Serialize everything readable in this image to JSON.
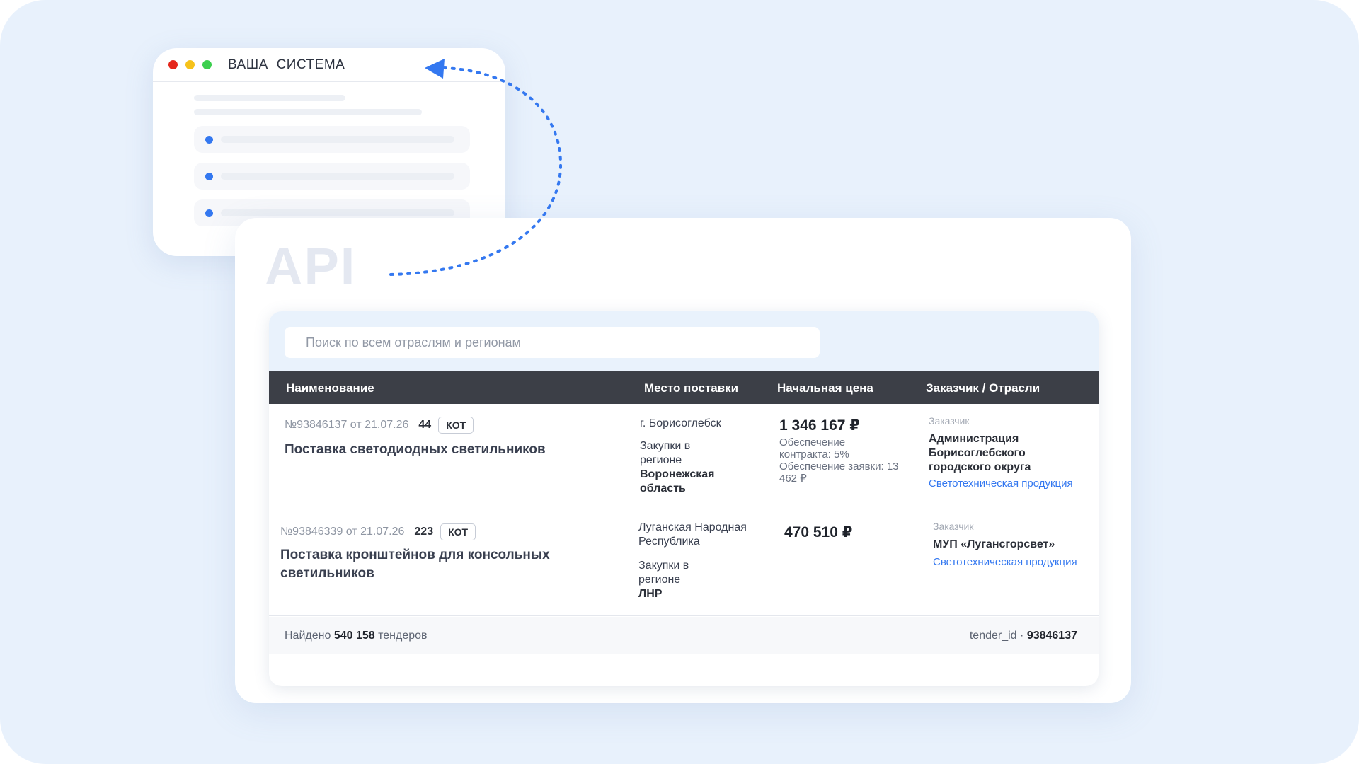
{
  "system_window": {
    "title": "ВАША СИСТЕМА",
    "dot_colors": [
      "#e5271b",
      "#f6c21a",
      "#3ccf4e"
    ]
  },
  "api_card": {
    "label": "API"
  },
  "search": {
    "placeholder": "Поиск по всем отраслям и регионам"
  },
  "table": {
    "columns": [
      "Наименование",
      "Место поставки",
      "Начальная цена",
      "Заказчик / Отрасли"
    ],
    "rows": [
      {
        "number": "№93846137 от 21.07.26",
        "law": "44",
        "badge": "КОТ",
        "name": "Поставка светодиодных светильников",
        "city": "г. Борисоглебск",
        "region_label": "Закупки в регионе",
        "region": "Воронежская область",
        "price": "1 346 167 ₽",
        "price_note": "Обеспечение контракта: 5% Обеспечение заявки: 13 462 ₽",
        "customer_label": "Заказчик",
        "customer": "Администрация Борисоглебского городского округа",
        "industry": "Светотехническая продукция"
      },
      {
        "number": "№93846339 от 21.07.26",
        "law": "223",
        "badge": "КОТ",
        "name": "Поставка кронштейнов для консольных светильников",
        "city": "Луганская Народная Республика",
        "region_label": "Закупки в регионе",
        "region": "ЛНР",
        "price": "470 510 ₽",
        "price_note": "",
        "customer_label": "Заказчик",
        "customer": "МУП «Лугансгорсвет»",
        "industry": "Светотехническая продукция"
      }
    ]
  },
  "footer": {
    "found_prefix": "Найдено",
    "found_count": "540 158",
    "found_suffix": "тендеров",
    "tender_id_label": "tender_id ·",
    "tender_id_value": "93846137"
  },
  "colors": {
    "background": "#e8f1fc",
    "accent": "#3478f0",
    "table_header": "#3c3f47"
  }
}
